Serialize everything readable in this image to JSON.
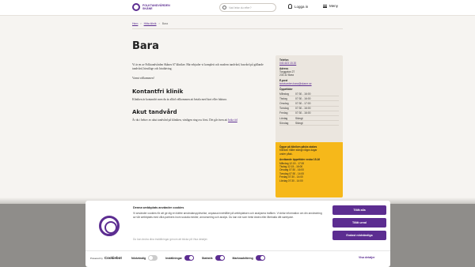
{
  "header": {
    "logo_text": "FOLKTANDVÅRDEN SKÅNE",
    "search_placeholder": "Vad letar du efter?",
    "login_label": "Logga in",
    "menu_label": "Meny"
  },
  "breadcrumb": [
    "Hem",
    "Hitta klinik",
    "Bara"
  ],
  "page": {
    "title": "Bara",
    "intro": "Vi är en av Folktandvården Skånes 67 kliniker. Här erbjuder vi komplett och modern tandvård, basvård på gällande tandvård, hirutläge och hirahäving.",
    "welcome": "Varmt välkommen!",
    "h_contactless": "Kontantfri klinik",
    "p_contactless": "Kliniken är kontantfri men du är alltid välkommen att betala med kort eller faktura.",
    "h_acute": "Akut tandvård",
    "p_acute": "Är du i behov av akut tandvård på kliniken, vänligen ring oss först. Det går även att",
    "p_acute_link": "boka tid"
  },
  "card": {
    "phone_label": "Telefon",
    "phone": "040-623 15 20",
    "address_label": "Adress",
    "address1": "Torggatan 27",
    "address2": "233 32 Bara",
    "email_label": "E-post",
    "email": "tandvarden.bara@skane.se",
    "hours_label": "Öppettider",
    "hours": [
      {
        "day": "Måndag",
        "time": "07:30 - 16:00"
      },
      {
        "day": "Tisdag",
        "time": "07:30 - 16:00"
      },
      {
        "day": "Onsdag",
        "time": "07:30 - 17:00"
      },
      {
        "day": "Torsdag",
        "time": "07:30 - 16:00"
      },
      {
        "day": "Fredag",
        "time": "07:30 - 16:00"
      },
      {
        "day": "Lördag",
        "time": "Stängt"
      },
      {
        "day": "Söndag",
        "time": "Stängt"
      }
    ]
  },
  "notice": {
    "title": "Ögyar på kliniken påsks stakes",
    "line1": "Kliniken håller stängt några dagar",
    "line2": "under påsk.",
    "subtitle": "Avvikande öppettider vecka 15-16",
    "rows": [
      "Måndag 12.15 - 17:00",
      "Tisdag 12.15 - 16:00",
      "Onsdag 07:30 - 16:00",
      "Torsdag 07:30 - 14:00",
      "Fredag 07:30 - 14:00",
      "Lördag 07:30 - 14:00"
    ]
  },
  "cookie": {
    "title": "Denna webbplats använder cookies",
    "body": "Vi använder cookies för att ge dig en bättre användarupplevelse, anpassa innehållet på webbplatsen och analysera trafiken. Vi delar information om din användning av vår webbplats med våra partners inom sociala medier, annonsering och analys. Du kan när som helst ändra eller återkalla ditt samtycke.",
    "more": "Du kan ändra dina inställningar genom att klicka på Visa detaljer.",
    "btn_allow": "Tillåt alla",
    "btn_selection": "Tillåt urval",
    "btn_necessary": "Endast nödvändiga",
    "powered": "Powered by",
    "brand": "Cookiebot",
    "toggles": [
      {
        "label": "Nödvändig"
      },
      {
        "label": "Inställningar"
      },
      {
        "label": "Statistik"
      },
      {
        "label": "Marknadsföring"
      }
    ],
    "details": "Visa detaljer"
  }
}
